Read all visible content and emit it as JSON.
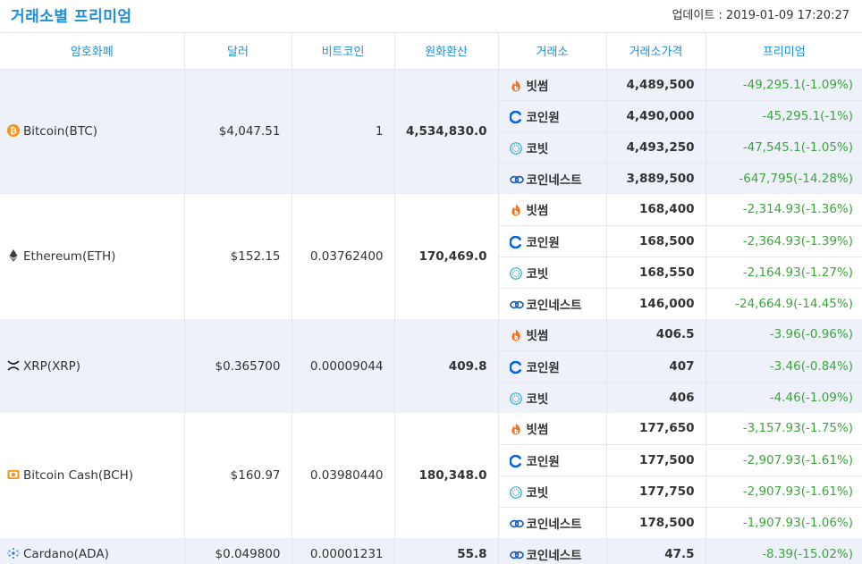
{
  "header": {
    "title": "거래소별 프리미엄",
    "updated": "업데이트 : 2019-01-09 17:20:27"
  },
  "columns": [
    "암호화폐",
    "달러",
    "비트코인",
    "원화환산",
    "거래소",
    "거래소가격",
    "프리미엄"
  ],
  "colors": {
    "accent": "#1d8fd6",
    "premium": "#3aa63a",
    "alt_row": "#eef1fa"
  },
  "coins": [
    {
      "name": "Bitcoin(BTC)",
      "icon": "bitcoin-icon",
      "usd": "$4,047.51",
      "btc": "1",
      "krw": "4,534,830.0",
      "exchanges": [
        {
          "name": "빗썸",
          "icon": "bithumb-icon",
          "price": "4,489,500",
          "premium": "-49,295.1(-1.09%)"
        },
        {
          "name": "코인원",
          "icon": "coinone-icon",
          "price": "4,490,000",
          "premium": "-45,295.1(-1%)"
        },
        {
          "name": "코빗",
          "icon": "korbit-icon",
          "price": "4,493,250",
          "premium": "-47,545.1(-1.05%)"
        },
        {
          "name": "코인네스트",
          "icon": "coinnest-icon",
          "price": "3,889,500",
          "premium": "-647,795(-14.28%)"
        }
      ]
    },
    {
      "name": "Ethereum(ETH)",
      "icon": "ethereum-icon",
      "usd": "$152.15",
      "btc": "0.03762400",
      "krw": "170,469.0",
      "exchanges": [
        {
          "name": "빗썸",
          "icon": "bithumb-icon",
          "price": "168,400",
          "premium": "-2,314.93(-1.36%)"
        },
        {
          "name": "코인원",
          "icon": "coinone-icon",
          "price": "168,500",
          "premium": "-2,364.93(-1.39%)"
        },
        {
          "name": "코빗",
          "icon": "korbit-icon",
          "price": "168,550",
          "premium": "-2,164.93(-1.27%)"
        },
        {
          "name": "코인네스트",
          "icon": "coinnest-icon",
          "price": "146,000",
          "premium": "-24,664.9(-14.45%)"
        }
      ]
    },
    {
      "name": "XRP(XRP)",
      "icon": "xrp-icon",
      "usd": "$0.365700",
      "btc": "0.00009044",
      "krw": "409.8",
      "exchanges": [
        {
          "name": "빗썸",
          "icon": "bithumb-icon",
          "price": "406.5",
          "premium": "-3.96(-0.96%)"
        },
        {
          "name": "코인원",
          "icon": "coinone-icon",
          "price": "407",
          "premium": "-3.46(-0.84%)"
        },
        {
          "name": "코빗",
          "icon": "korbit-icon",
          "price": "406",
          "premium": "-4.46(-1.09%)"
        }
      ]
    },
    {
      "name": "Bitcoin Cash(BCH)",
      "icon": "bitcoin-cash-icon",
      "usd": "$160.97",
      "btc": "0.03980440",
      "krw": "180,348.0",
      "exchanges": [
        {
          "name": "빗썸",
          "icon": "bithumb-icon",
          "price": "177,650",
          "premium": "-3,157.93(-1.75%)"
        },
        {
          "name": "코인원",
          "icon": "coinone-icon",
          "price": "177,500",
          "premium": "-2,907.93(-1.61%)"
        },
        {
          "name": "코빗",
          "icon": "korbit-icon",
          "price": "177,750",
          "premium": "-2,907.93(-1.61%)"
        },
        {
          "name": "코인네스트",
          "icon": "coinnest-icon",
          "price": "178,500",
          "premium": "-1,907.93(-1.06%)"
        }
      ]
    },
    {
      "name": "Cardano(ADA)",
      "icon": "cardano-icon",
      "usd": "$0.049800",
      "btc": "0.00001231",
      "krw": "55.8",
      "exchanges": [
        {
          "name": "코인네스트",
          "icon": "coinnest-icon",
          "price": "47.5",
          "premium": "-8.39(-15.02%)"
        }
      ]
    }
  ]
}
